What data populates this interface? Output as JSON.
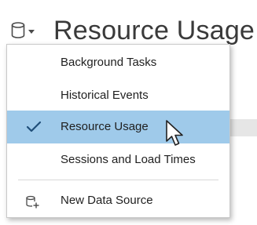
{
  "header": {
    "title": "Resource Usage",
    "datasource_icon": "database-icon",
    "dropdown_icon": "caret-down-icon"
  },
  "menu": {
    "items": [
      {
        "label": "Background Tasks",
        "selected": false
      },
      {
        "label": "Historical Events",
        "selected": false
      },
      {
        "label": "Resource Usage",
        "selected": true,
        "icon": "checkmark-icon"
      },
      {
        "label": "Sessions and Load Times",
        "selected": false
      }
    ],
    "footer_item": {
      "label": "New Data Source",
      "icon": "add-database-icon"
    }
  },
  "colors": {
    "selected_bg": "#9fcaea",
    "title_text": "#3a3a3a",
    "checkmark": "#1f4e79"
  }
}
